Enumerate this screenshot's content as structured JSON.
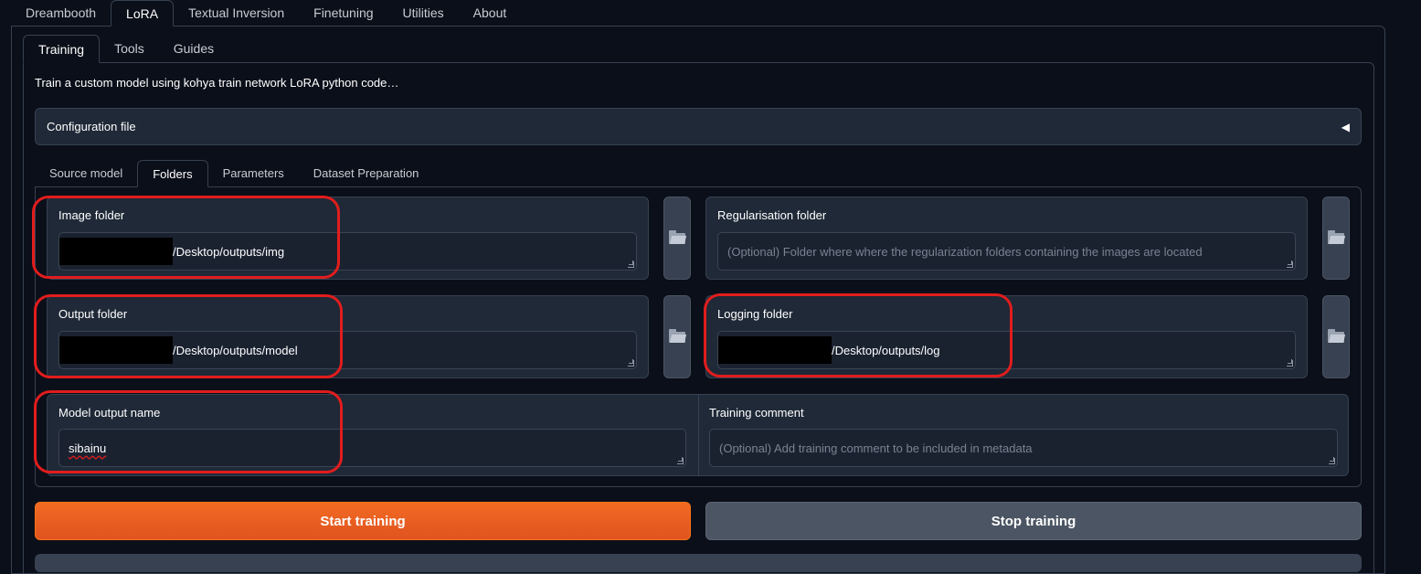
{
  "top_tabs": [
    {
      "label": "Dreambooth",
      "active": false
    },
    {
      "label": "LoRA",
      "active": true
    },
    {
      "label": "Textual Inversion",
      "active": false
    },
    {
      "label": "Finetuning",
      "active": false
    },
    {
      "label": "Utilities",
      "active": false
    },
    {
      "label": "About",
      "active": false
    }
  ],
  "sub_tabs": [
    {
      "label": "Training",
      "active": true
    },
    {
      "label": "Tools",
      "active": false
    },
    {
      "label": "Guides",
      "active": false
    }
  ],
  "description": "Train a custom model using kohya train network LoRA python code…",
  "config_accordion": {
    "label": "Configuration file",
    "caret": "◀"
  },
  "inner_tabs": [
    {
      "label": "Source model",
      "active": false
    },
    {
      "label": "Folders",
      "active": true
    },
    {
      "label": "Parameters",
      "active": false
    },
    {
      "label": "Dataset Preparation",
      "active": false
    }
  ],
  "fields": {
    "image_folder": {
      "label": "Image folder",
      "value": "/Desktop/outputs/img"
    },
    "reg_folder": {
      "label": "Regularisation folder",
      "placeholder": "(Optional) Folder where where the regularization folders containing the images are located"
    },
    "output_folder": {
      "label": "Output folder",
      "value": "/Desktop/outputs/model"
    },
    "logging_folder": {
      "label": "Logging folder",
      "value": "/Desktop/outputs/log"
    },
    "model_output_name": {
      "label": "Model output name",
      "value": "sibainu"
    },
    "training_comment": {
      "label": "Training comment",
      "placeholder": "(Optional) Add training comment to be included in metadata"
    }
  },
  "buttons": {
    "start": "Start training",
    "stop": "Stop training"
  },
  "colors": {
    "background": "#0b0f19",
    "accent": "#f26b23",
    "highlight": "#e11d1d"
  },
  "icons": {
    "folder_button": "folder-icon"
  }
}
